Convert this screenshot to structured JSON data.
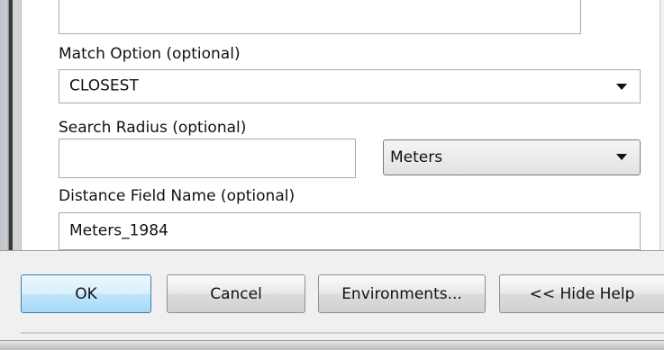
{
  "form": {
    "match_option_label": "Match Option (optional)",
    "match_option_value": "CLOSEST",
    "search_radius_label": "Search Radius (optional)",
    "search_radius_value": "",
    "search_radius_unit": "Meters",
    "distance_field_label": "Distance Field Name (optional)",
    "distance_field_value": "Meters_1984"
  },
  "buttons": {
    "ok": "OK",
    "cancel": "Cancel",
    "environments": "Environments...",
    "hide_help": "<< Hide Help"
  },
  "icons": {
    "dropdown": "chevron-down-icon"
  }
}
